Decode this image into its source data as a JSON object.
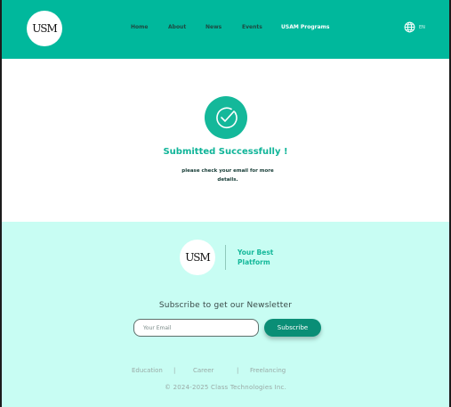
{
  "header": {
    "logo_text": "USM",
    "nav": [
      "Home",
      "About",
      "News",
      "Events",
      "USAM Programs"
    ],
    "language": "EN"
  },
  "main": {
    "title": "Submitted Successfully !",
    "message": "please check your email for more details."
  },
  "footer": {
    "logo_text": "USM",
    "tagline": "Your Best Platform",
    "newsletter_title": "Subscribe to get our Newsletter",
    "email_placeholder": "Your Email",
    "subscribe_label": "Subscribe",
    "links": [
      "Education",
      "Career",
      "Freelancing"
    ],
    "separator": "|",
    "copyright": "© 2024-2025 Class Technologies Inc."
  },
  "colors": {
    "header_bg": "#00b89c",
    "accent": "#14b89a",
    "footer_bg": "#c8fdf3",
    "button_bg": "#0a8e76"
  },
  "icons": {
    "language": "globe-icon",
    "success": "check-circle-icon"
  }
}
